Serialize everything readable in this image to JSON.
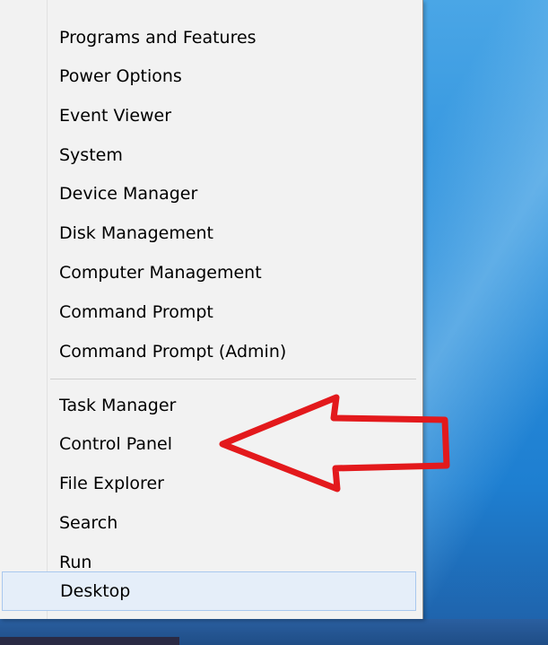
{
  "menu": {
    "groups": [
      {
        "items": [
          {
            "label": "Programs and Features"
          },
          {
            "label": "Power Options"
          },
          {
            "label": "Event Viewer"
          },
          {
            "label": "System"
          },
          {
            "label": "Device Manager"
          },
          {
            "label": "Disk Management"
          },
          {
            "label": "Computer Management"
          },
          {
            "label": "Command Prompt"
          },
          {
            "label": "Command Prompt (Admin)"
          }
        ]
      },
      {
        "items": [
          {
            "label": "Task Manager"
          },
          {
            "label": "Control Panel"
          },
          {
            "label": "File Explorer"
          },
          {
            "label": "Search"
          },
          {
            "label": "Run"
          }
        ]
      },
      {
        "items": [
          {
            "label": "Desktop",
            "highlighted": true
          }
        ]
      }
    ]
  },
  "annotation": {
    "type": "arrow",
    "points_to": "Control Panel",
    "color": "#e3191c"
  },
  "colors": {
    "menu_background": "#f2f2f2",
    "desktop_background": "#2b8fdc",
    "highlight_background": "#e5eef9",
    "highlight_border": "#a9c8ee"
  }
}
